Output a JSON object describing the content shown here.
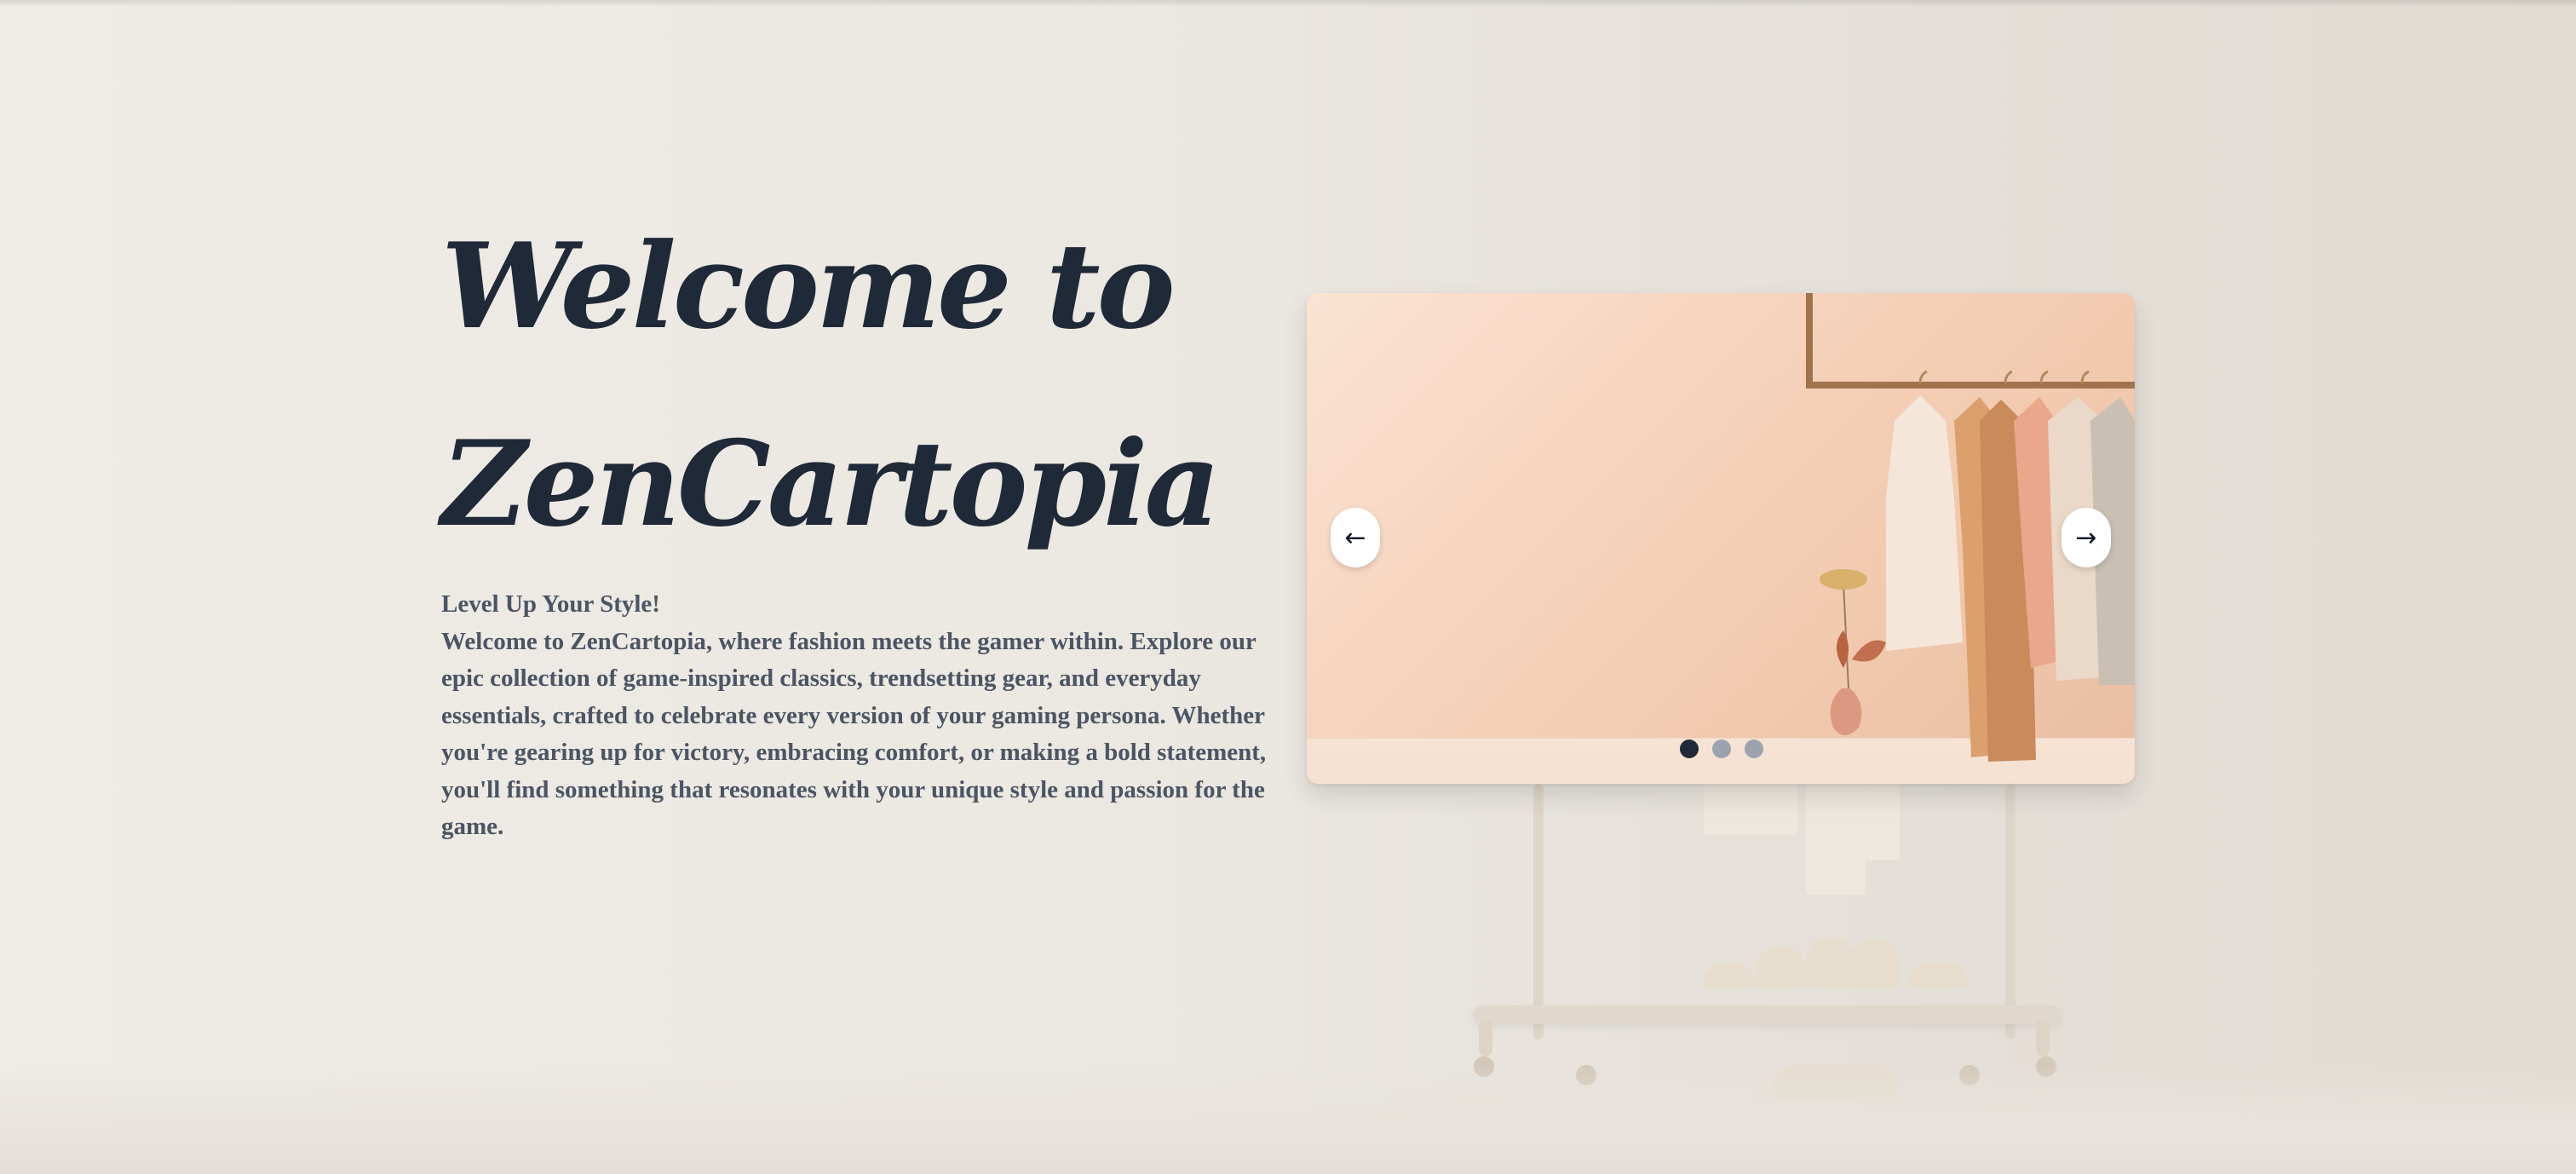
{
  "hero": {
    "title_line1": "Welcome to",
    "title_line2": "ZenCartopia",
    "subtitle": "Level Up Your Style!",
    "description": "Welcome to ZenCartopia, where fashion meets the gamer within. Explore our epic collection of game-inspired classics, trendsetting gear, and everyday essentials, crafted to celebrate every version of your gaming persona. Whether you're gearing up for victory, embracing comfort, or making a bold statement, you'll find something that resonates with your unique style and passion for the game."
  },
  "slider": {
    "prev_icon": "arrow-left-icon",
    "next_icon": "arrow-right-icon",
    "prev_label": "←",
    "next_label": "→",
    "slide_count": 3,
    "active_slide": 1
  },
  "colors": {
    "heading": "#1f2937",
    "body_text": "#4b5563",
    "dot_active": "#1f2937",
    "dot_inactive": "#9ca3af"
  }
}
